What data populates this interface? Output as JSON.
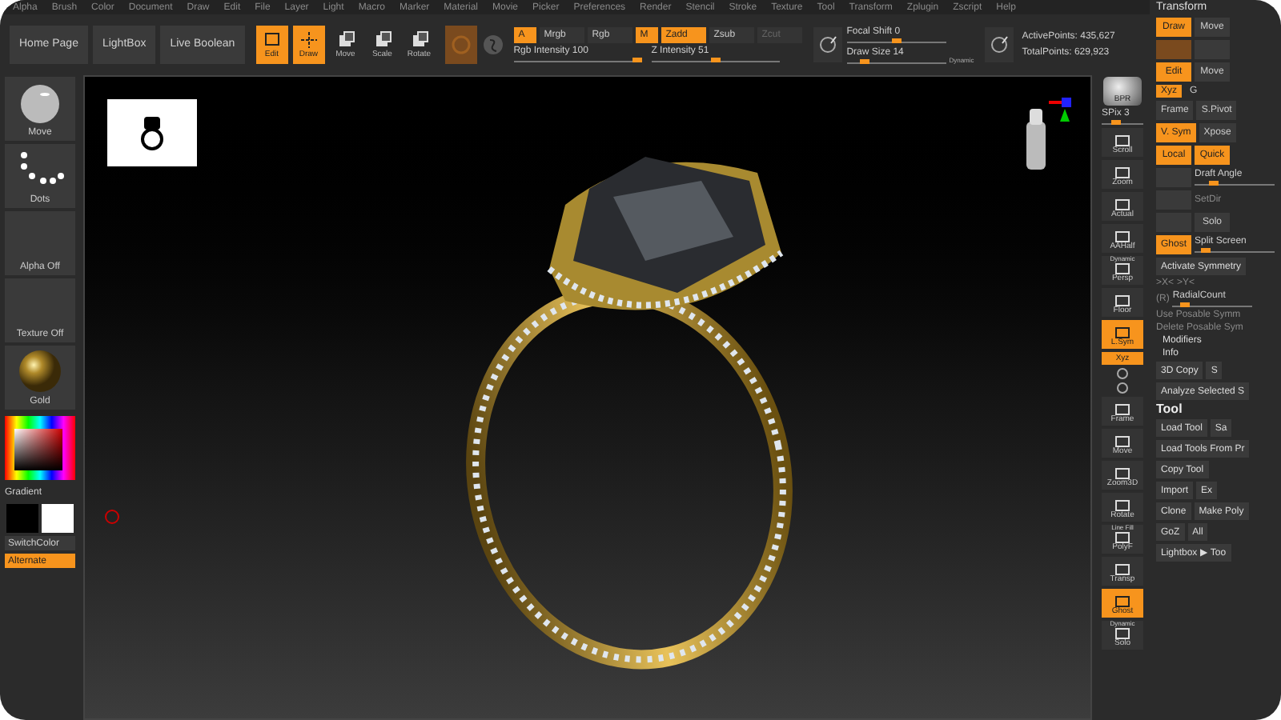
{
  "menu_bar": {
    "items": [
      "Alpha",
      "Brush",
      "Color",
      "Document",
      "Draw",
      "Edit",
      "File",
      "Layer",
      "Light",
      "Macro",
      "Marker",
      "Material",
      "Movie",
      "Picker",
      "Preferences",
      "Render",
      "Stencil",
      "Stroke",
      "Texture",
      "Tool",
      "Transform",
      "Zplugin",
      "Zscript",
      "Help"
    ]
  },
  "shelf": {
    "nav_buttons": [
      "Home Page",
      "LightBox",
      "Live Boolean"
    ],
    "tools": [
      {
        "label": "Edit",
        "selected": true
      },
      {
        "label": "Draw",
        "selected": true
      },
      {
        "label": "Move",
        "selected": false
      },
      {
        "label": "Scale",
        "selected": false
      },
      {
        "label": "Rotate",
        "selected": false
      }
    ],
    "channels": [
      {
        "label": "A",
        "selected": true,
        "disabled": false
      },
      {
        "label": "Mrgb",
        "selected": false,
        "disabled": false
      },
      {
        "label": "Rgb",
        "selected": false,
        "disabled": false
      },
      {
        "label": "M",
        "selected": true,
        "disabled": false
      },
      {
        "label": "Zadd",
        "selected": true,
        "disabled": false
      },
      {
        "label": "Zsub",
        "selected": false,
        "disabled": false
      },
      {
        "label": "Zcut",
        "selected": false,
        "disabled": true
      }
    ],
    "intensity_sliders": [
      {
        "label": "Rgb Intensity 100",
        "level": 1
      },
      {
        "label": "Z Intensity 51",
        "level": 0.51
      }
    ],
    "stroke_sliders": [
      {
        "label": "Focal Shift 0",
        "level": 0.5
      },
      {
        "label": "Draw Size 14",
        "level": 0.14
      }
    ],
    "dynamic": "Dynamic",
    "stats": [
      "ActivePoints: 435,627",
      "TotalPoints: 629,923"
    ]
  },
  "left_panel": {
    "thumbnails": [
      {
        "label": "Move",
        "kind": "brush"
      },
      {
        "label": "Dots",
        "kind": "stroke"
      },
      {
        "label": "Alpha Off",
        "kind": "empty"
      },
      {
        "label": "Texture Off",
        "kind": "empty"
      },
      {
        "label": "Gold",
        "kind": "material"
      }
    ],
    "gradient": "Gradient",
    "switch_color": "SwitchColor",
    "alternate": "Alternate"
  },
  "right_toolbar": [
    {
      "kind": "sphere",
      "label": "BPR"
    },
    {
      "kind": "slider",
      "label": "SPix 3",
      "level": 0.3
    },
    {
      "kind": "button",
      "label": "Scroll",
      "selected": false
    },
    {
      "kind": "button",
      "label": "Zoom",
      "selected": false
    },
    {
      "kind": "button",
      "label": "Actual",
      "selected": false
    },
    {
      "kind": "button",
      "label": "AAHalf",
      "selected": false
    },
    {
      "kind": "button",
      "label": "Persp",
      "caption": "Dynamic",
      "selected": false
    },
    {
      "kind": "button",
      "label": "Floor",
      "selected": false
    },
    {
      "kind": "button",
      "label": "L.Sym",
      "selected": true
    },
    {
      "kind": "tab",
      "label": "Xyz",
      "selected": true
    },
    {
      "kind": "mini"
    },
    {
      "kind": "mini"
    },
    {
      "kind": "button",
      "label": "Frame",
      "selected": false
    },
    {
      "kind": "button",
      "label": "Move",
      "selected": false
    },
    {
      "kind": "button",
      "label": "Zoom3D",
      "selected": false
    },
    {
      "kind": "button",
      "label": "Rotate",
      "selected": false
    },
    {
      "kind": "button",
      "label": "PolyF",
      "caption": "Line Fill",
      "selected": false
    },
    {
      "kind": "button",
      "label": "Transp",
      "selected": false
    },
    {
      "kind": "button",
      "label": "Ghost",
      "selected": true
    },
    {
      "kind": "button",
      "label": "Solo",
      "caption": "Dynamic",
      "selected": false
    }
  ],
  "right_panel": {
    "title": "Transform",
    "rows": [
      [
        {
          "kind": "button",
          "label": "Draw",
          "selected": true
        },
        {
          "kind": "button",
          "label": "Move",
          "selected": false
        }
      ],
      [
        {
          "kind": "icon",
          "selected": true
        },
        {
          "kind": "icon",
          "selected": false
        }
      ],
      [
        {
          "kind": "button",
          "label": "Edit",
          "selected": true
        },
        {
          "kind": "button",
          "label": "Move",
          "selected": false
        }
      ],
      [
        {
          "kind": "tab",
          "label": "Xyz",
          "selected": true
        },
        {
          "kind": "tab",
          "label": "G",
          "selected": false
        }
      ],
      [
        {
          "kind": "button",
          "label": "Frame",
          "selected": false
        },
        {
          "kind": "button",
          "label": "S.Pivot",
          "selected": false
        }
      ],
      [
        {
          "kind": "button",
          "label": "V. Sym",
          "selected": true
        },
        {
          "kind": "button",
          "label": "Xpose",
          "selected": false
        }
      ],
      [
        {
          "kind": "button",
          "label": "Local",
          "selected": true
        },
        {
          "kind": "button",
          "label": "Quick",
          "selected": true
        }
      ],
      [
        {
          "kind": "icon",
          "selected": false
        },
        {
          "kind": "slider",
          "label": "Draft Angle",
          "level": 0.2
        }
      ],
      [
        {
          "kind": "icon",
          "selected": false
        },
        {
          "kind": "text",
          "label": "SetDir"
        }
      ],
      [
        {
          "kind": "icon",
          "selected": false
        },
        {
          "kind": "button",
          "label": "Solo",
          "selected": false
        }
      ],
      [
        {
          "kind": "button",
          "label": "Ghost",
          "selected": true
        },
        {
          "kind": "slider",
          "label": "Split Screen",
          "level": 0.1
        }
      ],
      [
        {
          "kind": "wide",
          "label": "Activate Symmetry"
        }
      ],
      [
        {
          "kind": "text",
          "label": ">X<"
        },
        {
          "kind": "text",
          "label": ">Y<"
        }
      ],
      [
        {
          "kind": "text",
          "label": "(R)"
        },
        {
          "kind": "slider",
          "label": "RadialCount",
          "level": 0.1
        }
      ],
      [
        {
          "kind": "text",
          "label": "Use Posable Symm"
        }
      ],
      [
        {
          "kind": "text",
          "label": "Delete Posable Sym"
        }
      ],
      [
        {
          "kind": "heading",
          "label": "Modifiers"
        }
      ],
      [
        {
          "kind": "heading",
          "label": "Info"
        }
      ],
      [
        {
          "kind": "wide",
          "label": "3D Copy"
        },
        {
          "kind": "wide",
          "label": "S"
        }
      ],
      [
        {
          "kind": "wide",
          "label": "Analyze Selected S"
        }
      ],
      [
        {
          "kind": "title",
          "label": "Tool"
        }
      ],
      [
        {
          "kind": "wide",
          "label": "Load Tool"
        },
        {
          "kind": "wide",
          "label": "Sa"
        }
      ],
      [
        {
          "kind": "wide",
          "label": "Load Tools From Pr"
        }
      ],
      [
        {
          "kind": "wide",
          "label": "Copy Tool"
        }
      ],
      [
        {
          "kind": "wide",
          "label": "Import"
        },
        {
          "kind": "wide",
          "label": "Ex"
        }
      ],
      [
        {
          "kind": "wide",
          "label": "Clone"
        },
        {
          "kind": "wide",
          "label": "Make Poly"
        }
      ],
      [
        {
          "kind": "wide",
          "label": "GoZ"
        },
        {
          "kind": "wide",
          "label": "All"
        }
      ],
      [
        {
          "kind": "wide",
          "label": "Lightbox ▶ Too"
        }
      ]
    ]
  }
}
